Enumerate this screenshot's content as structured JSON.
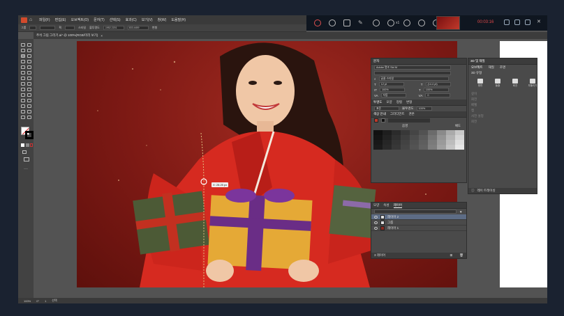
{
  "app": {
    "menu": [
      "파일(F)",
      "편집(E)",
      "오브젝트(O)",
      "문자(T)",
      "선택(S)",
      "효과(C)",
      "보기(V)",
      "창(W)",
      "도움말(H)"
    ]
  },
  "recorder": {
    "timer": "00:03:16",
    "zoom_label": "x1"
  },
  "document_tab": {
    "title": "추석 그림 그리기.ai* @ 100%(RGB/미리 보기)"
  },
  "options_bar": {
    "label_group": "그룹",
    "label_style": "스타일",
    "label_opacity": "불투명도",
    "x_value": "-1952.2201",
    "y_value": "833.4459",
    "transform_label": "변형",
    "stroke_label": "획"
  },
  "canvas": {
    "measure_tooltip": "X: 28.25 px"
  },
  "character_panel": {
    "tab_label": "문자",
    "font_name": "Adobe 명조 Std M",
    "font_style": "",
    "style_dropdown": "글꼴 스타일",
    "size_value": "12 pt",
    "leading_value": "(14.4 pt)",
    "scale_h": "100%",
    "scale_v": "100%",
    "kerning": "자동",
    "tracking": "0",
    "opacity_tabs": [
      "투명도",
      "모양",
      "정렬",
      "변형"
    ],
    "blend_mode": "표준",
    "opacity_label": "불투명도",
    "opacity_value": "100%",
    "color_tabs": [
      "색상 안내",
      "그라디언트",
      "견본"
    ],
    "harmony_label": "음영",
    "harmony_label_right": "채도"
  },
  "layers_panel": {
    "tabs": [
      "모양",
      "속성",
      "레이어"
    ],
    "active_tab": "레이어",
    "layers": [
      {
        "name": "레이어 2",
        "selected": true
      },
      {
        "name": "그룹",
        "selected": false
      },
      {
        "name": "레이어 1",
        "selected": false
      }
    ],
    "footer_count": "3 레이어"
  },
  "fx_panel": {
    "tab_label": "3D 및 재질",
    "subtabs": [
      "오브젝트",
      "재질",
      "조명"
    ],
    "section_label": "3D 유형",
    "types": [
      "평면",
      "돌출",
      "회전",
      "부풀리기"
    ],
    "labels": [
      "깊이",
      "회전",
      "베벨",
      "캡",
      "사전 설정",
      "회전"
    ],
    "footer": "레이 트레이싱"
  },
  "status": {
    "zoom": "100%",
    "angle": "0°",
    "page": "1",
    "tool": "선택"
  },
  "colors": {
    "accent_selected": "#5d6c85",
    "artboard_bg": "#7c1914",
    "timer_color": "#e04848"
  },
  "swatch_rows": [
    [
      "#111111",
      "#1e1e1e",
      "#2b2b2b",
      "#383838",
      "#454545",
      "#525252",
      "#6b6b6b",
      "#8a8a8a",
      "#aaaaaa",
      "#c8c8c8"
    ],
    [
      "#141414",
      "#222222",
      "#303030",
      "#3e3e3e",
      "#4c4c4c",
      "#5a5a5a",
      "#747474",
      "#949494",
      "#b4b4b4",
      "#d4d4d4"
    ],
    [
      "#181818",
      "#262626",
      "#343434",
      "#424242",
      "#505050",
      "#5e5e5e",
      "#7a7a7a",
      "#9a9a9a",
      "#bcbcbc",
      "#dedede"
    ],
    [
      "#1b1b1b",
      "#292929",
      "#373737",
      "#454545",
      "#535353",
      "#616161",
      "#7e7e7e",
      "#a0a0a0",
      "#c4c4c4",
      "#e6e6e6"
    ]
  ]
}
